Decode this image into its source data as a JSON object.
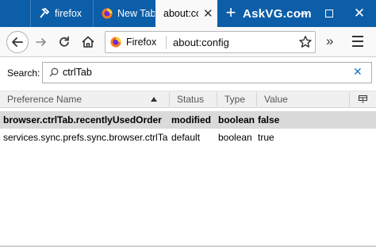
{
  "tabs": [
    {
      "label": "firefox",
      "icon": "tool-icon"
    },
    {
      "label": "New Tab",
      "icon": "firefox-icon"
    },
    {
      "label": "about:config",
      "icon": "",
      "active": true
    }
  ],
  "watermark": "AskVG.com",
  "navbar": {
    "identity_label": "Firefox",
    "url": "about:config"
  },
  "search": {
    "label": "Search:",
    "value": "ctrlTab"
  },
  "table": {
    "columns": [
      "Preference Name",
      "Status",
      "Type",
      "Value"
    ],
    "rows": [
      {
        "name": "browser.ctrlTab.recentlyUsedOrder",
        "status": "modified",
        "type": "boolean",
        "value": "false",
        "selected": true
      },
      {
        "name": "services.sync.prefs.sync.browser.ctrlTab...",
        "status": "default",
        "type": "boolean",
        "value": "true",
        "selected": false
      }
    ]
  },
  "colors": {
    "tabstrip": "#0c5ea8",
    "selected_row": "#dadada",
    "clear_icon": "#1a6fc0"
  }
}
